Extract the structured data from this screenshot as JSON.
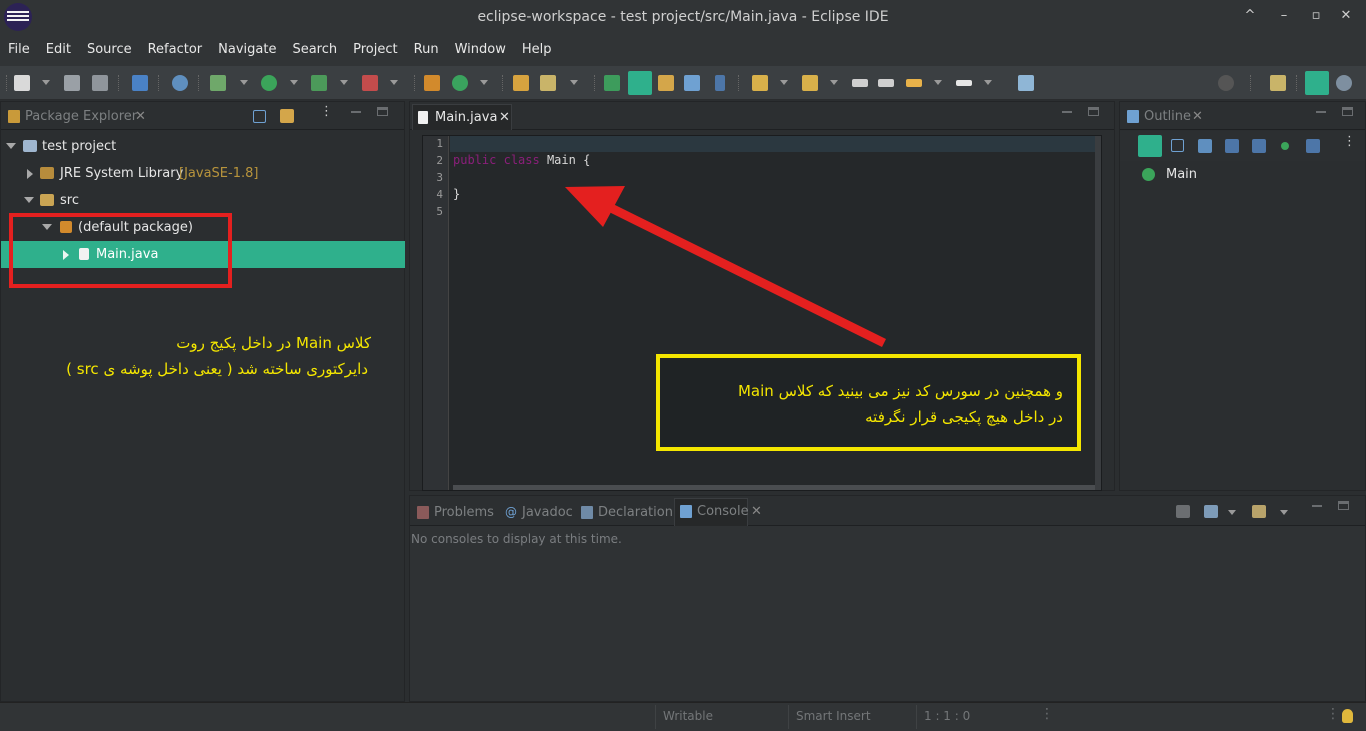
{
  "window": {
    "title": "eclipse-workspace - test project/src/Main.java - Eclipse IDE",
    "controls": [
      "^",
      "–",
      "▫",
      "✕"
    ]
  },
  "menu": [
    "File",
    "Edit",
    "Source",
    "Refactor",
    "Navigate",
    "Search",
    "Project",
    "Run",
    "Window",
    "Help"
  ],
  "package_explorer": {
    "tab_label": "Package Explorer",
    "tree": [
      {
        "label": "test project",
        "extra": ""
      },
      {
        "label": "JRE System Library",
        "extra": "[JavaSE-1.8]"
      },
      {
        "label": "src",
        "extra": ""
      },
      {
        "label": "(default package)",
        "extra": ""
      },
      {
        "label": "Main.java",
        "extra": ""
      }
    ]
  },
  "editor": {
    "tab_label": "Main.java",
    "line_numbers": [
      "1",
      "2",
      "3",
      "4",
      "5"
    ],
    "code": [
      {
        "kw1": "",
        "kw2": "",
        "rest": ""
      },
      {
        "kw1": "public",
        "kw2": "class",
        "rest": " Main {"
      },
      {
        "kw1": "",
        "kw2": "",
        "rest": ""
      },
      {
        "kw1": "",
        "kw2": "",
        "rest": "}"
      },
      {
        "kw1": "",
        "kw2": "",
        "rest": ""
      }
    ]
  },
  "outline": {
    "tab_label": "Outline",
    "items": [
      "Main"
    ]
  },
  "bottom": {
    "tabs": [
      "Problems",
      "Javadoc",
      "Declaration",
      "Console"
    ],
    "active": "Console",
    "message": "No consoles to display at this time."
  },
  "status": {
    "writable": "Writable",
    "insert_mode": "Smart Insert",
    "position": "1 : 1 : 0"
  },
  "annotations": {
    "left_line1": "کلاس Main در داخل پکیج روت",
    "left_line2": "دایرکتوری ساخته شد ( یعنی داخل پوشه ی  src )",
    "right_line1": "و همچنین در سورس کد نیز می بینید که کلاس Main",
    "right_line2": "در داخل هیچ پکیجی قرار نگرفته"
  },
  "colors": {
    "selection": "#2fb08c",
    "annotation_red": "#e4201f",
    "annotation_yellow": "#f4e600",
    "keyword": "#8a1f7a"
  }
}
